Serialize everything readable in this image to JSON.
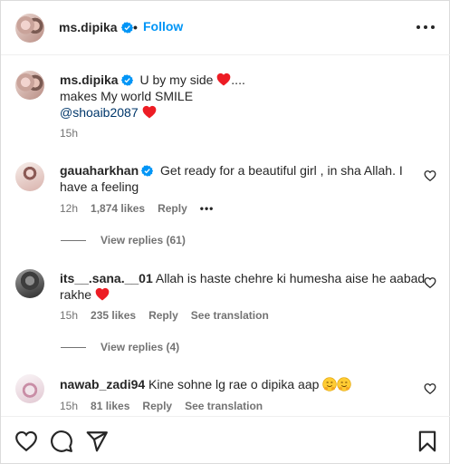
{
  "header": {
    "username": "ms.dipika",
    "separator": "•",
    "follow_label": "Follow"
  },
  "caption": {
    "username": "ms.dipika",
    "line1": "U by my side",
    "line1_suffix": "....",
    "line2": "makes My world SMILE",
    "mention": "@shoaib2087",
    "time": "15h"
  },
  "comments": [
    {
      "username": "gauaharkhan",
      "verified": true,
      "text_line1": "Get ready for a beautiful girl , in sha Allah. I",
      "text_line2": "have a feeling",
      "time": "12h",
      "likes": "1,874 likes",
      "reply": "Reply",
      "options": "•••",
      "view_replies": "View replies (61)"
    },
    {
      "username": "its__.sana.__01",
      "verified": false,
      "text_line1": "Allah is haste chehre ki humesha aise he aabad",
      "text_line2": "rakhe",
      "time": "15h",
      "likes": "235 likes",
      "reply": "Reply",
      "see_translation": "See translation",
      "view_replies": "View replies (4)"
    },
    {
      "username": "nawab_zadi94",
      "verified": false,
      "text_line1": "Kine sohne lg rae o dipika aap",
      "time": "15h",
      "likes": "81 likes",
      "reply": "Reply",
      "see_translation": "See translation"
    }
  ],
  "colors": {
    "accent": "#0095f6",
    "verified": "#0095f6",
    "heart": "#ed1c24",
    "muted": "#737373",
    "text": "#262626",
    "mention": "#00376b"
  },
  "icons": {
    "like": "heart-outline-icon",
    "comment": "speech-bubble-icon",
    "share": "paper-plane-icon",
    "save": "bookmark-icon",
    "more": "more-options-icon"
  }
}
